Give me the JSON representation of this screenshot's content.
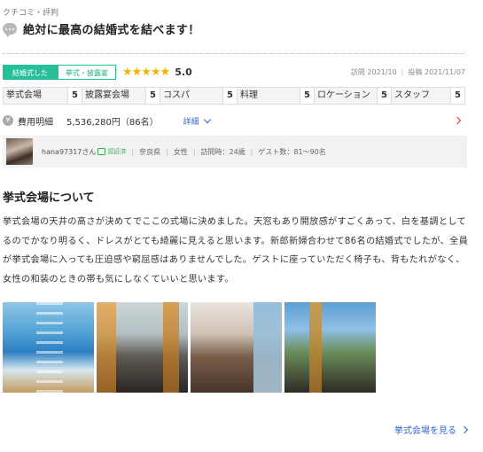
{
  "breadcrumb": "クチコミ・評判",
  "review": {
    "title": "絶対に最高の結婚式を結べます！",
    "status_primary": "結婚式した",
    "status_secondary": "挙式・披露宴",
    "stars": "★★★★★",
    "rating": "5.0",
    "visit_date": "訪問 2021/10",
    "post_date": "投稿 2021/11/07"
  },
  "scores": [
    {
      "label": "挙式会場",
      "value": "5"
    },
    {
      "label": "披露宴会場",
      "value": "5"
    },
    {
      "label": "コスパ",
      "value": "5"
    },
    {
      "label": "料理",
      "value": "5"
    },
    {
      "label": "ロケーション",
      "value": "5"
    },
    {
      "label": "スタッフ",
      "value": "5"
    }
  ],
  "cost": {
    "icon": "¥",
    "label": "費用明細",
    "amount": "5,536,280円（86名）",
    "detail_link": "詳細"
  },
  "user": {
    "name": "hana97317さん",
    "verified": "認証済",
    "prefecture": "奈良県",
    "gender": "女性",
    "age": "訪問時：24歳",
    "guests": "ゲスト数：81〜90名"
  },
  "section": {
    "title": "挙式会場について",
    "body": "挙式会場の天井の高さが決めてでここの式場に決めました。天窓もあり開放感がすごくあって、白を基調としてるのでかなり明るく、ドレスがとても綺麗に見えると思います。新郎新婦合わせて86名の結婚式でしたが、全員が挙式会場に入っても圧迫感や窮屈感はありませんでした。ゲストに座っていただく椅子も、背もたれがなく、女性の和装のときの帯も気にしなくていいと思います。"
  },
  "more_link": "挙式会場を見る",
  "colors": {
    "accent_green": "#25c09a",
    "star_yellow": "#f2b400",
    "link_blue": "#3366cc",
    "arrow_red": "#dd3333"
  }
}
